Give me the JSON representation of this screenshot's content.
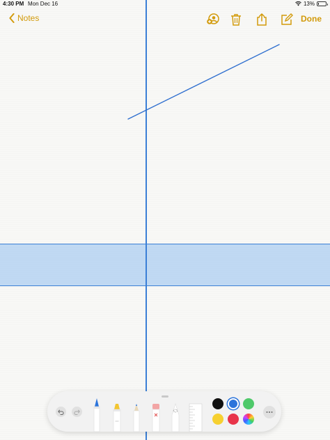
{
  "status_bar": {
    "time": "4:30 PM",
    "date": "Mon Dec 16",
    "battery_percent": "13%",
    "battery_level": 0.13
  },
  "navbar": {
    "back_label": "Notes",
    "done_label": "Done",
    "icons": [
      "add-person-icon",
      "trash-icon",
      "share-icon",
      "compose-icon"
    ]
  },
  "colors": {
    "accent": "#d29a0a",
    "guide": "#3a7fd6",
    "ink": "#2f6fcf"
  },
  "toolbar": {
    "tools": [
      "pen",
      "marker",
      "pencil",
      "eraser",
      "lasso",
      "ruler"
    ],
    "swatches": [
      {
        "name": "black",
        "color": "#111111",
        "selected": false
      },
      {
        "name": "blue",
        "color": "#2b74db",
        "selected": true
      },
      {
        "name": "green",
        "color": "#4fc96a",
        "selected": false
      },
      {
        "name": "yellow",
        "color": "#f6d030",
        "selected": false
      },
      {
        "name": "red",
        "color": "#e8344a",
        "selected": false
      },
      {
        "name": "multicolor",
        "color": "conic",
        "selected": false
      }
    ]
  }
}
